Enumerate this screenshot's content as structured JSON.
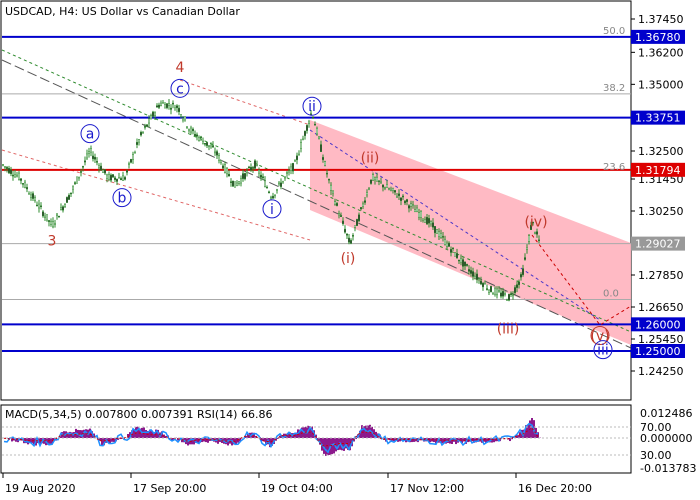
{
  "title": "USDCAD, H4:  US Dollar vs Canadian Dollar",
  "indicator_label": "MACD(5,34,5) 0.007800 0.007391 RSI(14) 66.86",
  "colors": {
    "blue_line": "#0000cc",
    "red_line": "#dd0000",
    "channel_fill": "#ffb3be",
    "wave_red": "#c0392b",
    "wave_blue": "#1a1acc",
    "candle": "#2e8b2e",
    "macd_hist": "#800080",
    "rsi_line": "#1e90ff",
    "signal_line": "#cc0000"
  },
  "chart_data": {
    "type": "candlestick",
    "symbol": "USDCAD",
    "timeframe": "H4",
    "ylim": [
      1.2325,
      1.3822
    ],
    "price_ticks": [
      "1.37450",
      "1.36200",
      "1.35000",
      "1.33751",
      "1.32500",
      "1.31450",
      "1.30250",
      "1.29027",
      "1.27850",
      "1.26650",
      "1.25450",
      "1.24250"
    ],
    "time_ticks": [
      "19 Aug 2020",
      "17 Sep 20:00",
      "19 Oct 04:00",
      "17 Nov 12:00",
      "16 Dec 20:00"
    ],
    "horizontal_levels": [
      {
        "name": "resistance",
        "price": 1.3678,
        "label": "1.36780",
        "color": "blue"
      },
      {
        "name": "resistance",
        "price": 1.33751,
        "label": "1.33751",
        "color": "blue"
      },
      {
        "name": "pivot",
        "price": 1.31794,
        "label": "1.31794",
        "color": "red"
      },
      {
        "name": "current",
        "price": 1.29027,
        "label": "1.29027",
        "color": "gray"
      },
      {
        "name": "support",
        "price": 1.26,
        "label": "1.26000",
        "color": "blue"
      },
      {
        "name": "support",
        "price": 1.25,
        "label": "1.25000",
        "color": "blue"
      }
    ],
    "fibonacci": [
      {
        "label": "50.0",
        "price": 1.3678
      },
      {
        "label": "38.2",
        "price": 1.3464
      },
      {
        "label": "23.6",
        "price": 1.3167
      },
      {
        "label": "0.0",
        "price": 1.2693
      }
    ],
    "wave_labels": [
      {
        "text": "4",
        "style": "plain",
        "color": "red",
        "x_date": "17 Sep 20:00",
        "price": 1.3565
      },
      {
        "text": "3",
        "style": "plain",
        "color": "red",
        "price": 1.2915
      },
      {
        "text": "a",
        "style": "circle",
        "color": "blue",
        "price": 1.3315
      },
      {
        "text": "b",
        "style": "circle",
        "color": "blue",
        "price": 1.3075
      },
      {
        "text": "c",
        "style": "circle",
        "color": "blue",
        "price": 1.3485
      },
      {
        "text": "ii",
        "style": "circle",
        "color": "blue",
        "price": 1.3418
      },
      {
        "text": "i",
        "style": "circle",
        "color": "blue",
        "price": 1.3033
      },
      {
        "text": "(ii)",
        "style": "plain",
        "color": "red",
        "price": 1.3225
      },
      {
        "text": "(i)",
        "style": "plain",
        "color": "red",
        "price": 1.2848
      },
      {
        "text": "(iv)",
        "style": "plain",
        "color": "red",
        "price": 1.2985
      },
      {
        "text": "(iii)",
        "style": "plain",
        "color": "red",
        "price": 1.2585
      },
      {
        "text": "(v)",
        "style": "circle",
        "color": "red",
        "price": 1.2558
      },
      {
        "text": "iii",
        "style": "circle",
        "color": "blue",
        "price": 1.2505
      }
    ],
    "indicator_ticks": [
      "0.012486",
      "70.00",
      "0.000000",
      "30.00",
      "-0.013783"
    ],
    "macd": {
      "main": 0.0078,
      "signal": 0.007391
    },
    "rsi": 66.86
  }
}
